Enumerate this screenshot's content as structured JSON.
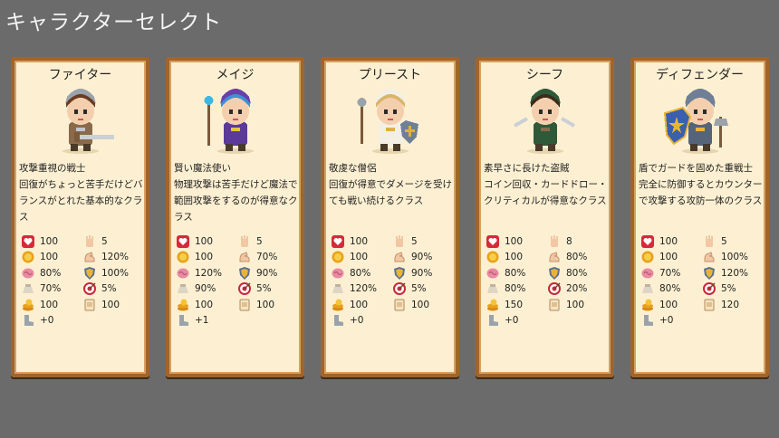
{
  "screen_title": "キャラクターセレクト",
  "characters": [
    {
      "name": "ファイター",
      "desc": [
        "攻撃重視の戦士",
        "回復がちょっと苦手だけどバ",
        "ランスがとれた基本的なクラ",
        "ス"
      ],
      "left": [
        "100",
        "100",
        "80%",
        "70%",
        "100",
        "+0"
      ],
      "right": [
        "5",
        "120%",
        "100%",
        "5%",
        "100"
      ],
      "portrait": "fighter-portrait"
    },
    {
      "name": "メイジ",
      "desc": [
        "賢い魔法使い",
        "物理攻撃は苦手だけど魔法で",
        "範囲攻撃をするのが得意なク",
        "ラス"
      ],
      "left": [
        "100",
        "100",
        "120%",
        "90%",
        "100",
        "+1"
      ],
      "right": [
        "5",
        "70%",
        "90%",
        "5%",
        "100"
      ],
      "portrait": "mage-portrait"
    },
    {
      "name": "プリースト",
      "desc": [
        "敬虔な僧侶",
        "回復が得意でダメージを受け",
        "ても戦い続けるクラス"
      ],
      "left": [
        "100",
        "100",
        "80%",
        "120%",
        "100",
        "+0"
      ],
      "right": [
        "5",
        "90%",
        "90%",
        "5%",
        "100"
      ],
      "portrait": "priest-portrait"
    },
    {
      "name": "シーフ",
      "desc": [
        "素早さに長けた盗賊",
        "コイン回収・カードドロー・",
        "クリティカルが得意なクラス"
      ],
      "left": [
        "100",
        "100",
        "80%",
        "80%",
        "150",
        "+0"
      ],
      "right": [
        "8",
        "80%",
        "80%",
        "20%",
        "100"
      ],
      "portrait": "thief-portrait"
    },
    {
      "name": "ディフェンダー",
      "desc": [
        "盾でガードを固めた重戦士",
        "完全に防御するとカウンター",
        "で攻撃する攻防一体のクラス"
      ],
      "left": [
        "100",
        "100",
        "70%",
        "80%",
        "100",
        "+0"
      ],
      "right": [
        "5",
        "100%",
        "120%",
        "5%",
        "120"
      ],
      "portrait": "defender-portrait"
    }
  ],
  "stat_icons_left": [
    "heart-icon",
    "coin-icon",
    "brain-icon",
    "sack-icon",
    "coin-stack-icon",
    "boot-icon"
  ],
  "stat_icons_right": [
    "hand-icon",
    "arm-icon",
    "shield-icon",
    "target-icon",
    "card-icon"
  ]
}
